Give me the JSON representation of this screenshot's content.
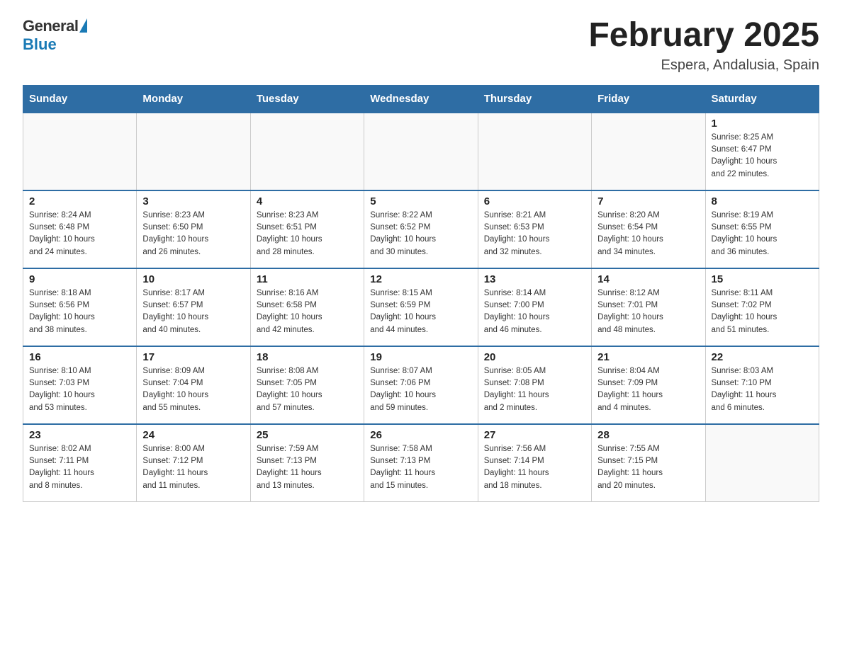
{
  "header": {
    "logo_general": "General",
    "logo_blue": "Blue",
    "title": "February 2025",
    "subtitle": "Espera, Andalusia, Spain"
  },
  "days_of_week": [
    "Sunday",
    "Monday",
    "Tuesday",
    "Wednesday",
    "Thursday",
    "Friday",
    "Saturday"
  ],
  "weeks": [
    [
      {
        "day": "",
        "info": ""
      },
      {
        "day": "",
        "info": ""
      },
      {
        "day": "",
        "info": ""
      },
      {
        "day": "",
        "info": ""
      },
      {
        "day": "",
        "info": ""
      },
      {
        "day": "",
        "info": ""
      },
      {
        "day": "1",
        "info": "Sunrise: 8:25 AM\nSunset: 6:47 PM\nDaylight: 10 hours\nand 22 minutes."
      }
    ],
    [
      {
        "day": "2",
        "info": "Sunrise: 8:24 AM\nSunset: 6:48 PM\nDaylight: 10 hours\nand 24 minutes."
      },
      {
        "day": "3",
        "info": "Sunrise: 8:23 AM\nSunset: 6:50 PM\nDaylight: 10 hours\nand 26 minutes."
      },
      {
        "day": "4",
        "info": "Sunrise: 8:23 AM\nSunset: 6:51 PM\nDaylight: 10 hours\nand 28 minutes."
      },
      {
        "day": "5",
        "info": "Sunrise: 8:22 AM\nSunset: 6:52 PM\nDaylight: 10 hours\nand 30 minutes."
      },
      {
        "day": "6",
        "info": "Sunrise: 8:21 AM\nSunset: 6:53 PM\nDaylight: 10 hours\nand 32 minutes."
      },
      {
        "day": "7",
        "info": "Sunrise: 8:20 AM\nSunset: 6:54 PM\nDaylight: 10 hours\nand 34 minutes."
      },
      {
        "day": "8",
        "info": "Sunrise: 8:19 AM\nSunset: 6:55 PM\nDaylight: 10 hours\nand 36 minutes."
      }
    ],
    [
      {
        "day": "9",
        "info": "Sunrise: 8:18 AM\nSunset: 6:56 PM\nDaylight: 10 hours\nand 38 minutes."
      },
      {
        "day": "10",
        "info": "Sunrise: 8:17 AM\nSunset: 6:57 PM\nDaylight: 10 hours\nand 40 minutes."
      },
      {
        "day": "11",
        "info": "Sunrise: 8:16 AM\nSunset: 6:58 PM\nDaylight: 10 hours\nand 42 minutes."
      },
      {
        "day": "12",
        "info": "Sunrise: 8:15 AM\nSunset: 6:59 PM\nDaylight: 10 hours\nand 44 minutes."
      },
      {
        "day": "13",
        "info": "Sunrise: 8:14 AM\nSunset: 7:00 PM\nDaylight: 10 hours\nand 46 minutes."
      },
      {
        "day": "14",
        "info": "Sunrise: 8:12 AM\nSunset: 7:01 PM\nDaylight: 10 hours\nand 48 minutes."
      },
      {
        "day": "15",
        "info": "Sunrise: 8:11 AM\nSunset: 7:02 PM\nDaylight: 10 hours\nand 51 minutes."
      }
    ],
    [
      {
        "day": "16",
        "info": "Sunrise: 8:10 AM\nSunset: 7:03 PM\nDaylight: 10 hours\nand 53 minutes."
      },
      {
        "day": "17",
        "info": "Sunrise: 8:09 AM\nSunset: 7:04 PM\nDaylight: 10 hours\nand 55 minutes."
      },
      {
        "day": "18",
        "info": "Sunrise: 8:08 AM\nSunset: 7:05 PM\nDaylight: 10 hours\nand 57 minutes."
      },
      {
        "day": "19",
        "info": "Sunrise: 8:07 AM\nSunset: 7:06 PM\nDaylight: 10 hours\nand 59 minutes."
      },
      {
        "day": "20",
        "info": "Sunrise: 8:05 AM\nSunset: 7:08 PM\nDaylight: 11 hours\nand 2 minutes."
      },
      {
        "day": "21",
        "info": "Sunrise: 8:04 AM\nSunset: 7:09 PM\nDaylight: 11 hours\nand 4 minutes."
      },
      {
        "day": "22",
        "info": "Sunrise: 8:03 AM\nSunset: 7:10 PM\nDaylight: 11 hours\nand 6 minutes."
      }
    ],
    [
      {
        "day": "23",
        "info": "Sunrise: 8:02 AM\nSunset: 7:11 PM\nDaylight: 11 hours\nand 8 minutes."
      },
      {
        "day": "24",
        "info": "Sunrise: 8:00 AM\nSunset: 7:12 PM\nDaylight: 11 hours\nand 11 minutes."
      },
      {
        "day": "25",
        "info": "Sunrise: 7:59 AM\nSunset: 7:13 PM\nDaylight: 11 hours\nand 13 minutes."
      },
      {
        "day": "26",
        "info": "Sunrise: 7:58 AM\nSunset: 7:13 PM\nDaylight: 11 hours\nand 15 minutes."
      },
      {
        "day": "27",
        "info": "Sunrise: 7:56 AM\nSunset: 7:14 PM\nDaylight: 11 hours\nand 18 minutes."
      },
      {
        "day": "28",
        "info": "Sunrise: 7:55 AM\nSunset: 7:15 PM\nDaylight: 11 hours\nand 20 minutes."
      },
      {
        "day": "",
        "info": ""
      }
    ]
  ]
}
